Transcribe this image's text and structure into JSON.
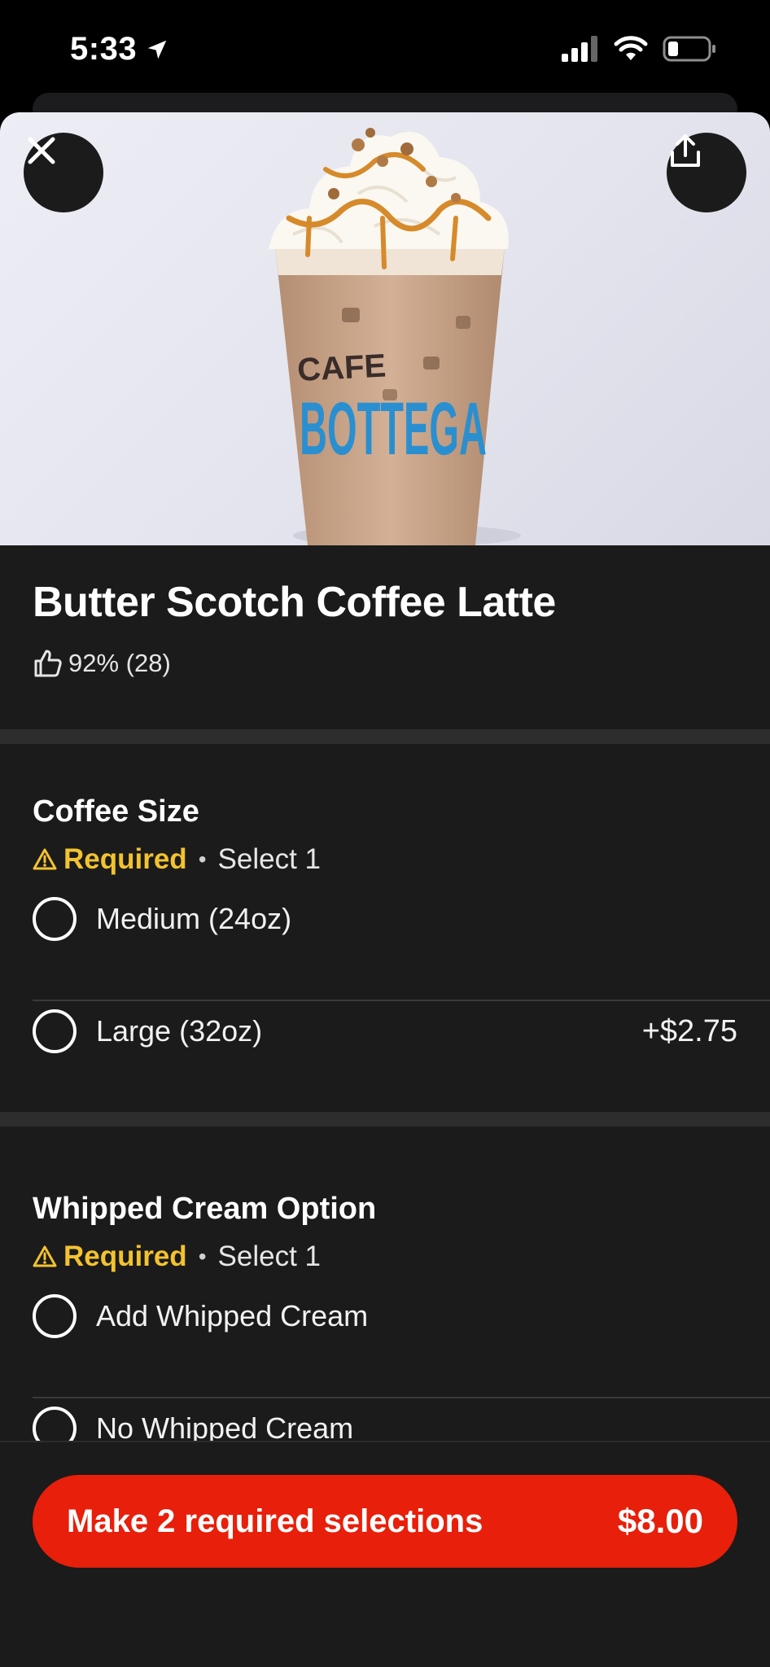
{
  "status_bar": {
    "time": "5:33",
    "location_icon": "location-arrow-icon",
    "signal_icon": "cellular-signal-icon",
    "wifi_icon": "wifi-icon",
    "battery_icon": "battery-low-icon"
  },
  "hero": {
    "close_icon": "close-icon",
    "share_icon": "share-icon",
    "cup_text_line1": "CAFE",
    "cup_text_line2": "BOTTEGA"
  },
  "item": {
    "title": "Butter Scotch Coffee Latte",
    "rating_icon": "thumbs-up-icon",
    "rating_text": "92% (28)"
  },
  "sections": [
    {
      "title": "Coffee Size",
      "warning_icon": "warning-icon",
      "required_label": "Required",
      "select_text": "Select 1",
      "options": [
        {
          "label": "Medium (24oz)",
          "price": ""
        },
        {
          "label": "Large (32oz)",
          "price": "+$2.75"
        }
      ]
    },
    {
      "title": "Whipped Cream Option",
      "warning_icon": "warning-icon",
      "required_label": "Required",
      "select_text": "Select 1",
      "options": [
        {
          "label": "Add Whipped Cream",
          "price": ""
        },
        {
          "label": "No Whipped Cream",
          "price": ""
        }
      ]
    }
  ],
  "cta": {
    "label": "Make 2 required selections",
    "price": "$8.00",
    "color": "#e81f0a"
  },
  "colors": {
    "required": "#f2c230",
    "background": "#1b1b1b"
  }
}
